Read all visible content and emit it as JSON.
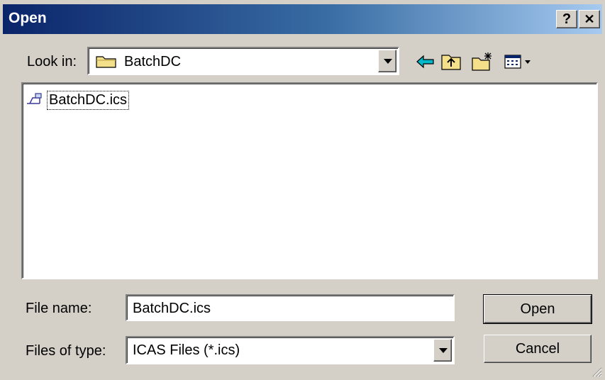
{
  "window": {
    "title": "Open",
    "help_label": "?",
    "close_label": "✕"
  },
  "lookin": {
    "label": "Look in:",
    "value": "BatchDC",
    "icon": "folder-icon"
  },
  "toolbar": {
    "icons": [
      "back-icon",
      "up-folder-icon",
      "new-folder-icon",
      "view-menu-icon"
    ]
  },
  "files": [
    {
      "name": "BatchDC.ics",
      "icon": "ics-file-icon",
      "focused": true
    }
  ],
  "filename": {
    "label": "File name:",
    "value": "BatchDC.ics"
  },
  "filetype": {
    "label": "Files of type:",
    "value": "ICAS Files (*.ics)"
  },
  "buttons": {
    "open": "Open",
    "cancel": "Cancel"
  },
  "colors": {
    "title_gradient_start": "#0a246a",
    "title_gradient_end": "#a6caf0",
    "dialog_bg": "#d4d0c8"
  }
}
